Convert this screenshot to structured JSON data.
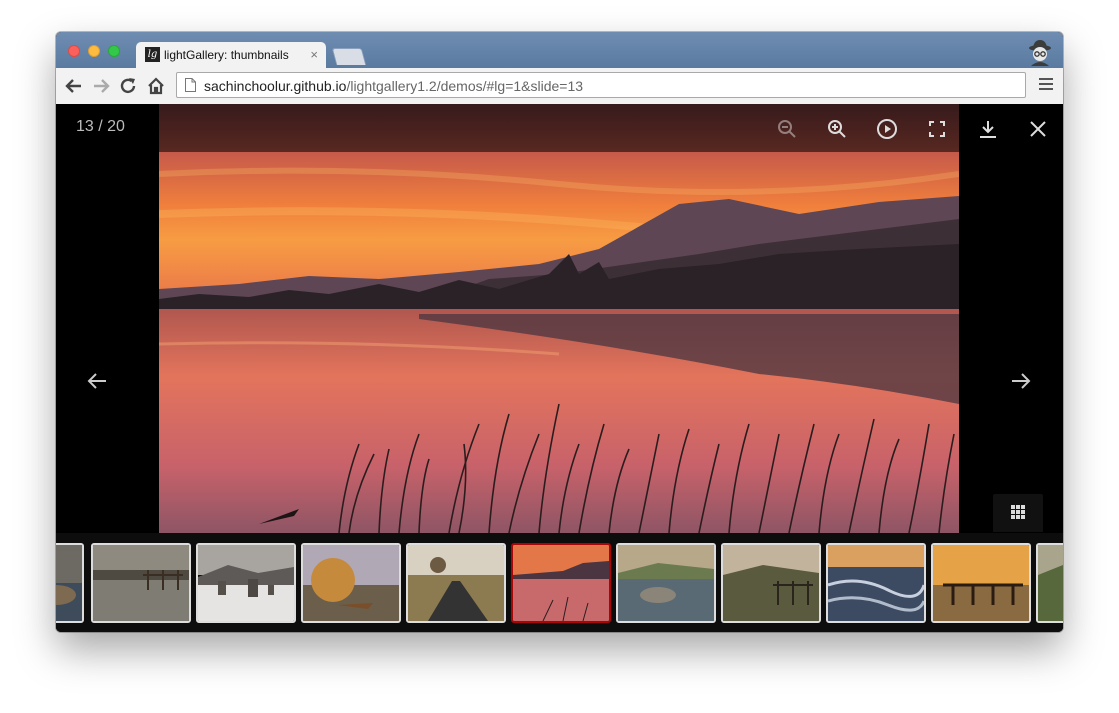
{
  "browser": {
    "tab_title": "lightGallery: thumbnails",
    "tab_close": "×",
    "url_host": "sachinchoolur.github.io",
    "url_path": "/lightgallery1.2/demos/#lg=1&slide=13",
    "favicon": "lg"
  },
  "gallery": {
    "counter": "13 / 20",
    "current_slide": 13,
    "total_slides": 20,
    "toolbar_icons": [
      "zoom-out-icon",
      "zoom-in-icon",
      "autoplay-icon",
      "fullscreen-icon",
      "download-icon",
      "close-icon"
    ],
    "zoom_out_disabled": true,
    "nav": [
      "arrow-left-icon",
      "arrow-right-icon"
    ],
    "thumbnails": [
      {
        "name": "reflection-rocks"
      },
      {
        "name": "flooded-fence"
      },
      {
        "name": "snowy-stone-circle"
      },
      {
        "name": "autumn-tree-boat"
      },
      {
        "name": "tree-lined-path"
      },
      {
        "name": "sunset-lake",
        "active": true
      },
      {
        "name": "lake-rocks"
      },
      {
        "name": "gate-valley"
      },
      {
        "name": "waves-shore"
      },
      {
        "name": "jetty-sunset"
      },
      {
        "name": "green-hills"
      }
    ],
    "active_border_color": "#a90707"
  }
}
